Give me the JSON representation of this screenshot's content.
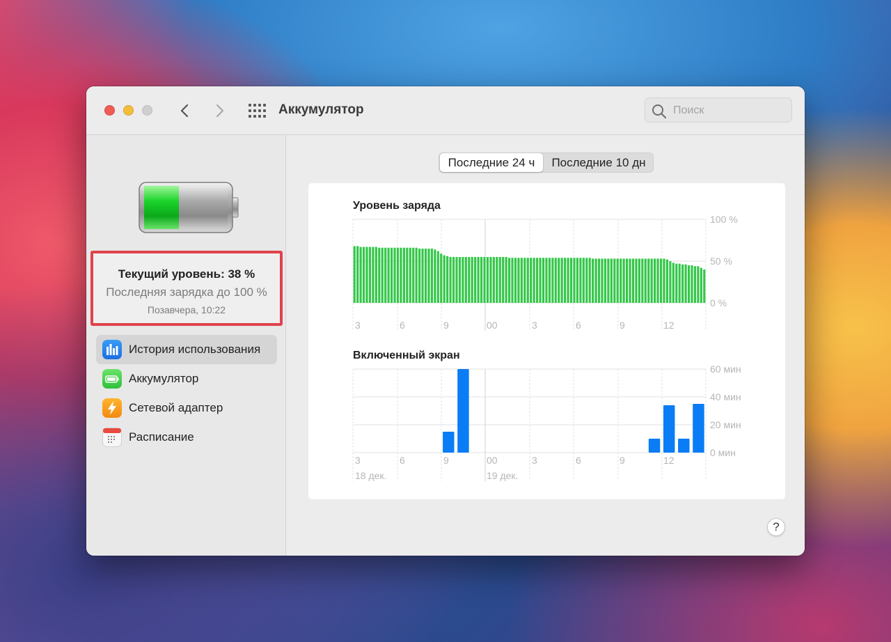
{
  "window": {
    "title": "Аккумулятор",
    "search_placeholder": "Поиск"
  },
  "sidebar": {
    "current_level": "Текущий уровень: 38 %",
    "last_charge": "Последняя зарядка до 100 %",
    "last_charge_time": "Позавчера, 10:22",
    "items": [
      {
        "label": "История использования",
        "icon": "usage-history-icon",
        "active": true
      },
      {
        "label": "Аккумулятор",
        "icon": "battery-icon",
        "active": false
      },
      {
        "label": "Сетевой адаптер",
        "icon": "power-adapter-icon",
        "active": false
      },
      {
        "label": "Расписание",
        "icon": "schedule-icon",
        "active": false
      }
    ]
  },
  "tabs": {
    "last_24h": "Последние 24 ч",
    "last_10d": "Последние 10 дн"
  },
  "help_label": "?",
  "colors": {
    "battery_bar": "#34c749",
    "screen_bar": "#0a7cf5",
    "highlight_border": "#e0424c"
  },
  "chart_data": [
    {
      "type": "bar",
      "title": "Уровень заряда",
      "x_tick_labels": [
        "3",
        "6",
        "9",
        "00",
        "3",
        "6",
        "9",
        "12"
      ],
      "y_tick_labels": [
        "100 %",
        "50 %",
        "0 %"
      ],
      "ylim": [
        0,
        100
      ],
      "grid": true,
      "values": [
        68,
        68,
        67,
        67,
        67,
        67,
        67,
        67,
        66,
        66,
        66,
        66,
        66,
        66,
        66,
        66,
        66,
        66,
        66,
        66,
        66,
        65,
        65,
        65,
        65,
        65,
        64,
        62,
        59,
        57,
        56,
        55,
        55,
        55,
        55,
        55,
        55,
        55,
        55,
        55,
        55,
        55,
        55,
        55,
        55,
        55,
        55,
        55,
        55,
        55,
        54,
        54,
        54,
        54,
        54,
        54,
        54,
        54,
        54,
        54,
        54,
        54,
        54,
        54,
        54,
        54,
        54,
        54,
        54,
        54,
        54,
        54,
        54,
        54,
        54,
        54,
        54,
        53,
        53,
        53,
        53,
        53,
        53,
        53,
        53,
        53,
        53,
        53,
        53,
        53,
        53,
        53,
        53,
        53,
        53,
        53,
        53,
        53,
        53,
        53,
        53,
        52,
        50,
        48,
        47,
        47,
        46,
        46,
        45,
        45,
        44,
        44,
        42,
        40
      ]
    },
    {
      "type": "bar",
      "title": "Включенный экран",
      "x_tick_labels": [
        "3",
        "6",
        "9",
        "00",
        "3",
        "6",
        "9",
        "12"
      ],
      "date_labels": [
        "18 дек.",
        "19 дек."
      ],
      "y_tick_labels": [
        "60 мин",
        "40 мин",
        "20 мин",
        "0 мин"
      ],
      "ylim": [
        0,
        60
      ],
      "grid": true,
      "values": [
        0,
        0,
        0,
        0,
        0,
        0,
        15,
        60,
        0,
        0,
        0,
        0,
        0,
        0,
        0,
        0,
        0,
        0,
        0,
        0,
        10,
        34,
        10,
        35
      ]
    }
  ]
}
